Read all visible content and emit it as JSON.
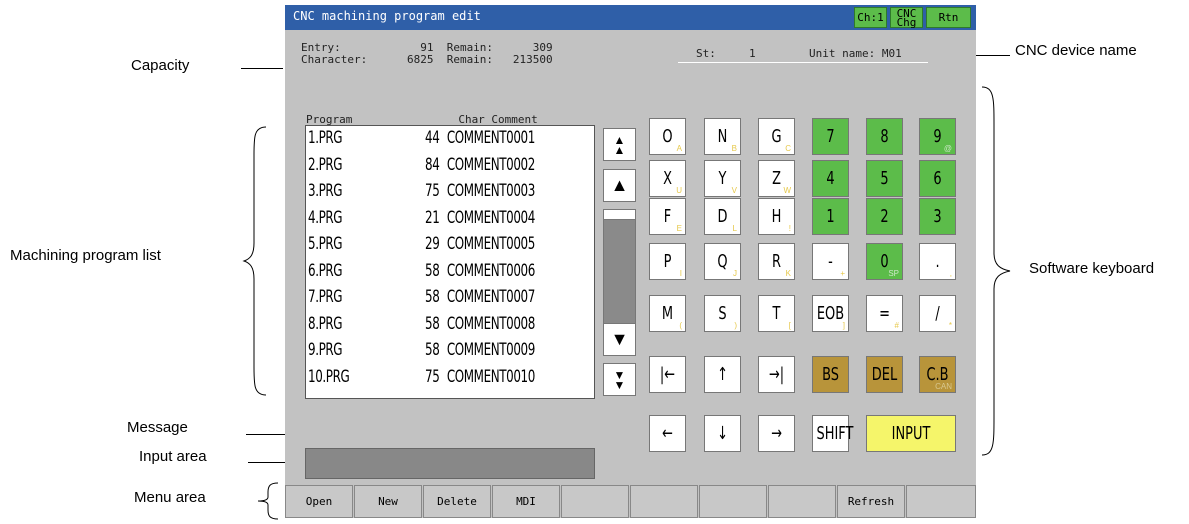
{
  "callouts": {
    "capacity": "Capacity",
    "cnc_device_name": "CNC device name",
    "program_list": "Machining program list",
    "software_keyboard": "Software keyboard",
    "message": "Message",
    "input_area": "Input area",
    "menu_area": "Menu area"
  },
  "titlebar": {
    "title": "CNC machining program edit",
    "ch_button": "Ch:1",
    "cnc_chg_top": "CNC",
    "cnc_chg_bottom": "Chg",
    "rtn_button": "Rtn"
  },
  "info": {
    "entry": "Entry:            91  Remain:      309",
    "character": "Character:      6825  Remain:   213500",
    "station": "St:     1",
    "unit_name": "Unit name: M01"
  },
  "program_list": {
    "header": "Program                Char Comment",
    "rows": [
      {
        "program": "1.PRG",
        "chars": "44",
        "comment": "COMMENT0001"
      },
      {
        "program": "2.PRG",
        "chars": "84",
        "comment": "COMMENT0002"
      },
      {
        "program": "3.PRG",
        "chars": "75",
        "comment": "COMMENT0003"
      },
      {
        "program": "4.PRG",
        "chars": "21",
        "comment": "COMMENT0004"
      },
      {
        "program": "5.PRG",
        "chars": "29",
        "comment": "COMMENT0005"
      },
      {
        "program": "6.PRG",
        "chars": "58",
        "comment": "COMMENT0006"
      },
      {
        "program": "7.PRG",
        "chars": "58",
        "comment": "COMMENT0007"
      },
      {
        "program": "8.PRG",
        "chars": "58",
        "comment": "COMMENT0008"
      },
      {
        "program": "9.PRG",
        "chars": "58",
        "comment": "COMMENT0009"
      },
      {
        "program": "10.PRG",
        "chars": "75",
        "comment": "COMMENT0010"
      }
    ]
  },
  "scrollbar": {
    "page_up": "▲▲",
    "line_up": "▲",
    "line_down": "▼",
    "page_down": "▼▼"
  },
  "keyboard": {
    "keys": [
      {
        "main": "O",
        "sub": "A",
        "color": "w"
      },
      {
        "main": "N",
        "sub": "B",
        "color": "w"
      },
      {
        "main": "G",
        "sub": "C",
        "color": "w"
      },
      {
        "main": "7",
        "sub": "",
        "color": "g"
      },
      {
        "main": "8",
        "sub": "",
        "color": "g"
      },
      {
        "main": "9",
        "sub": "@",
        "color": "g"
      },
      {
        "main": "X",
        "sub": "U",
        "color": "w"
      },
      {
        "main": "Y",
        "sub": "V",
        "color": "w"
      },
      {
        "main": "Z",
        "sub": "W",
        "color": "w"
      },
      {
        "main": "4",
        "sub": "",
        "color": "g"
      },
      {
        "main": "5",
        "sub": "",
        "color": "g"
      },
      {
        "main": "6",
        "sub": "",
        "color": "g"
      },
      {
        "main": "F",
        "sub": "E",
        "color": "w"
      },
      {
        "main": "D",
        "sub": "L",
        "color": "w"
      },
      {
        "main": "H",
        "sub": "!",
        "color": "w"
      },
      {
        "main": "1",
        "sub": "",
        "color": "g"
      },
      {
        "main": "2",
        "sub": "",
        "color": "g"
      },
      {
        "main": "3",
        "sub": "",
        "color": "g"
      },
      {
        "main": "P",
        "sub": "I",
        "color": "w"
      },
      {
        "main": "Q",
        "sub": "J",
        "color": "w"
      },
      {
        "main": "R",
        "sub": "K",
        "color": "w"
      },
      {
        "main": "-",
        "sub": "+",
        "color": "w"
      },
      {
        "main": "0",
        "sub": "SP",
        "color": "g"
      },
      {
        "main": ".",
        "sub": ",",
        "color": "w"
      },
      {
        "main": "M",
        "sub": "(",
        "color": "w"
      },
      {
        "main": "S",
        "sub": ")",
        "color": "w"
      },
      {
        "main": "T",
        "sub": "[",
        "color": "w"
      },
      {
        "main": "EOB",
        "sub": "]",
        "color": "w"
      },
      {
        "main": "=",
        "sub": "#",
        "color": "w"
      },
      {
        "main": "/",
        "sub": "*",
        "color": "w"
      },
      {
        "main": "|←",
        "sub": "",
        "color": "w"
      },
      {
        "main": "↑",
        "sub": "",
        "color": "w"
      },
      {
        "main": "→|",
        "sub": "",
        "color": "w"
      },
      {
        "main": "BS",
        "sub": "",
        "color": "b"
      },
      {
        "main": "DEL",
        "sub": "",
        "color": "b"
      },
      {
        "main": "C.B",
        "sub": "CAN",
        "color": "b"
      },
      {
        "main": "←",
        "sub": "",
        "color": "w"
      },
      {
        "main": "↓",
        "sub": "",
        "color": "w"
      },
      {
        "main": "→",
        "sub": "",
        "color": "w"
      },
      {
        "main": "SHIFT",
        "sub": "",
        "color": "w"
      }
    ],
    "input": "INPUT"
  },
  "message": "",
  "input_value": "",
  "menu": [
    "Open",
    "New",
    "Delete",
    "MDI",
    "",
    "",
    "",
    "",
    "Refresh",
    ""
  ]
}
